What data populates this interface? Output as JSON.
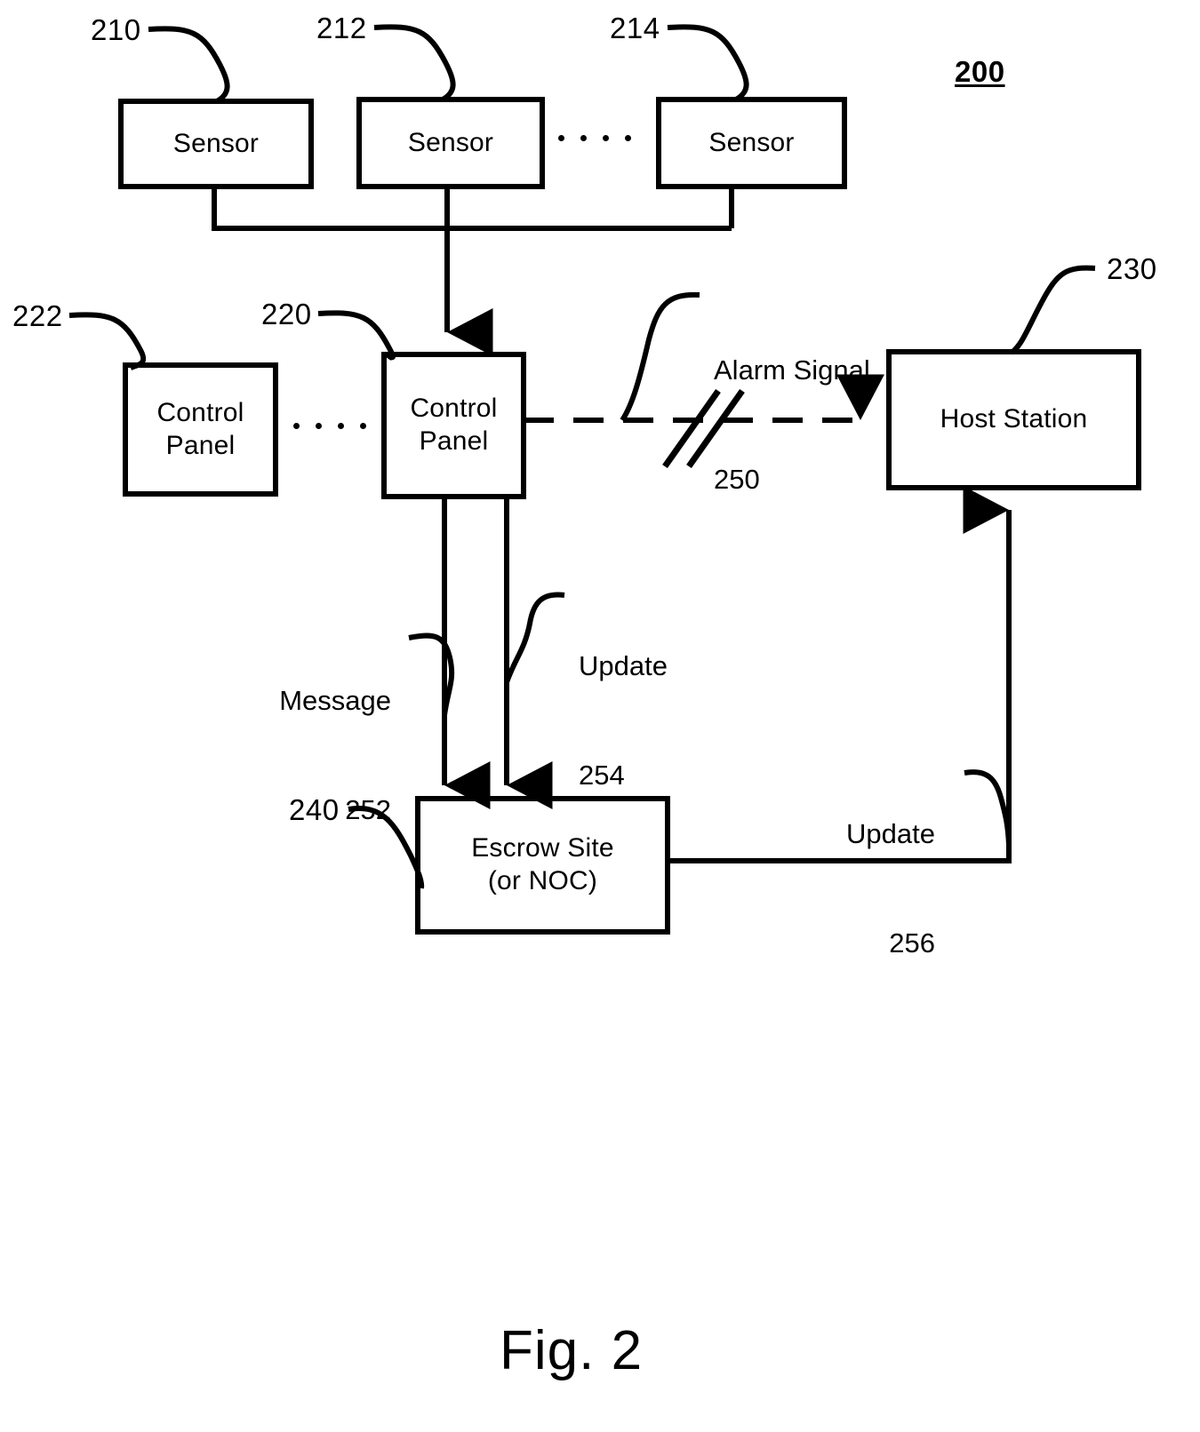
{
  "figure": {
    "caption": "Fig. 2",
    "figure_number_label": "200"
  },
  "nodes": [
    {
      "id": "sensor_1",
      "label": "Sensor",
      "ref": "210"
    },
    {
      "id": "sensor_2",
      "label": "Sensor",
      "ref": "212"
    },
    {
      "id": "sensor_n",
      "label": "Sensor",
      "ref": "214"
    },
    {
      "id": "panel_2",
      "label": "Control\nPanel",
      "ref": "222"
    },
    {
      "id": "panel_1",
      "label": "Control\nPanel",
      "ref": "220"
    },
    {
      "id": "host",
      "label": "Host Station",
      "ref": "230"
    },
    {
      "id": "escrow",
      "label": "Escrow Site\n(or NOC)",
      "ref": "240"
    }
  ],
  "node_labels": {
    "sensor_1": "Sensor",
    "sensor_2": "Sensor",
    "sensor_n": "Sensor",
    "panel_2_line1": "Control",
    "panel_2_line2": "Panel",
    "panel_1_line1": "Control",
    "panel_1_line2": "Panel",
    "host": "Host Station",
    "escrow_line1": "Escrow Site",
    "escrow_line2": "(or NOC)"
  },
  "ref_numbers": {
    "sensor_1": "210",
    "sensor_2": "212",
    "sensor_n": "214",
    "panel_2": "222",
    "panel_1": "220",
    "host": "230",
    "escrow": "240"
  },
  "signals": [
    {
      "id": "alarm",
      "name": "Alarm Signal",
      "ref": "250",
      "from": "panel_1",
      "to": "host",
      "style": "dashed"
    },
    {
      "id": "message",
      "name": "Message",
      "ref": "252",
      "from": "panel_1",
      "to": "escrow",
      "style": "solid"
    },
    {
      "id": "update254",
      "name": "Update",
      "ref": "254",
      "from": "panel_1",
      "to": "escrow",
      "style": "solid"
    },
    {
      "id": "update256",
      "name": "Update",
      "ref": "256",
      "from": "escrow",
      "to": "host",
      "style": "solid"
    }
  ],
  "signal_labels": {
    "alarm_name": "Alarm Signal",
    "alarm_ref": "250",
    "message_name": "Message",
    "message_ref": "252",
    "update254_name": "Update",
    "update254_ref": "254",
    "update256_name": "Update",
    "update256_ref": "256"
  },
  "colors": {
    "ink": "#000000",
    "paper": "#ffffff"
  }
}
